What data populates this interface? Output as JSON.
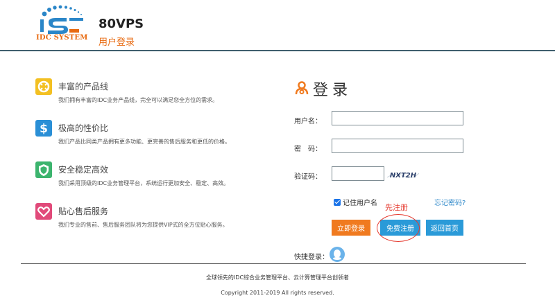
{
  "header": {
    "logo_text": "IDC SYSTEM",
    "site_title": "80VPS",
    "site_subtitle": "用户登录"
  },
  "features": [
    {
      "icon": "lifebuoy-icon",
      "color": "#f3c022",
      "title": "丰富的产品线",
      "desc": "我们拥有丰富的IDC业务产品线，完全可以满足您全方位的需求。"
    },
    {
      "icon": "dollar-icon",
      "color": "#2a8fd6",
      "title": "极高的性价比",
      "desc": "我们产品比同类产品拥有更多功能、更完善的售后服务和更低的价格。"
    },
    {
      "icon": "shield-icon",
      "color": "#3cb46e",
      "title": "安全稳定高效",
      "desc": "我们采用顶级的IDC业务管理平台，系统运行更加安全、稳定、高效。"
    },
    {
      "icon": "heart-icon",
      "color": "#e14a7a",
      "title": "贴心售后服务",
      "desc": "我们专业的售前、售后服务团队将为您提供VIP式的全方位贴心服务。"
    }
  ],
  "login": {
    "title": "登录",
    "username_label": "用户名：",
    "username_value": "",
    "password_label": "密　码：",
    "password_value": "",
    "captcha_label": "验证码：",
    "captcha_value": "",
    "captcha_text": "NXT2H",
    "remember_label": "记住用户名",
    "remember_checked": true,
    "forgot_label": "忘记密码?",
    "annotation": "先注册",
    "login_button": "立即登录",
    "register_button": "免费注册",
    "home_button": "返回首页",
    "quick_login_label": "快捷登录："
  },
  "footer": {
    "line1": "全球领先的IDC综合业务管理平台、云计算管理平台创领者",
    "line2": "Copyright 2011-2019 All rights reserved."
  },
  "colors": {
    "accent_orange": "#f07a1f",
    "accent_blue": "#2a9ad8",
    "annotation_red": "#e53a2f"
  }
}
